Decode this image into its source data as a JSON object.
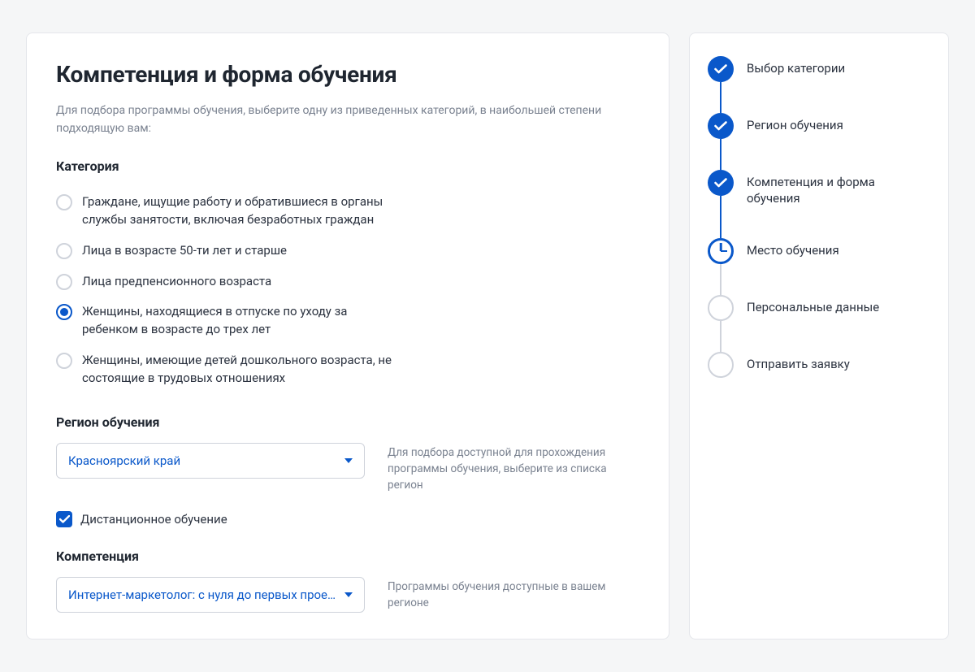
{
  "page_title": "Компетенция и форма обучения",
  "intro_text": "Для подбора программы обучения, выберите одну из приведенных категорий, в наибольшей степени подходящую вам:",
  "sections": {
    "category": {
      "heading": "Категория",
      "options": [
        {
          "label": "Граждане, ищущие работу и обратившиеся в органы службы занятости, включая безработных граждан",
          "selected": false
        },
        {
          "label": "Лица в возрасте 50-ти лет и старше",
          "selected": false
        },
        {
          "label": "Лица предпенсионного возраста",
          "selected": false
        },
        {
          "label": "Женщины, находящиеся в отпуске по уходу за ребенком в возрасте до трех лет",
          "selected": true
        },
        {
          "label": "Женщины, имеющие детей дошкольного возраста, не состоящие в трудовых отношениях",
          "selected": false
        }
      ]
    },
    "region": {
      "heading": "Регион обучения",
      "value": "Красноярский край",
      "hint": "Для подбора доступной для прохождения программы обучения, выберите из списка регион"
    },
    "remote": {
      "label": "Дистанционное обучение",
      "checked": true
    },
    "competence": {
      "heading": "Компетенция",
      "value": "Интернет-маркетолог: с нуля до первых прое…",
      "hint": "Программы обучения доступные в вашем регионе"
    }
  },
  "stepper": {
    "steps": [
      {
        "label": "Выбор категории",
        "state": "done"
      },
      {
        "label": "Регион обучения",
        "state": "done"
      },
      {
        "label": "Компетенция и форма обучения",
        "state": "done"
      },
      {
        "label": "Место обучения",
        "state": "current"
      },
      {
        "label": "Персональные данные",
        "state": "pending"
      },
      {
        "label": "Отправить заявку",
        "state": "pending"
      }
    ]
  },
  "colors": {
    "accent": "#0a58ca"
  }
}
